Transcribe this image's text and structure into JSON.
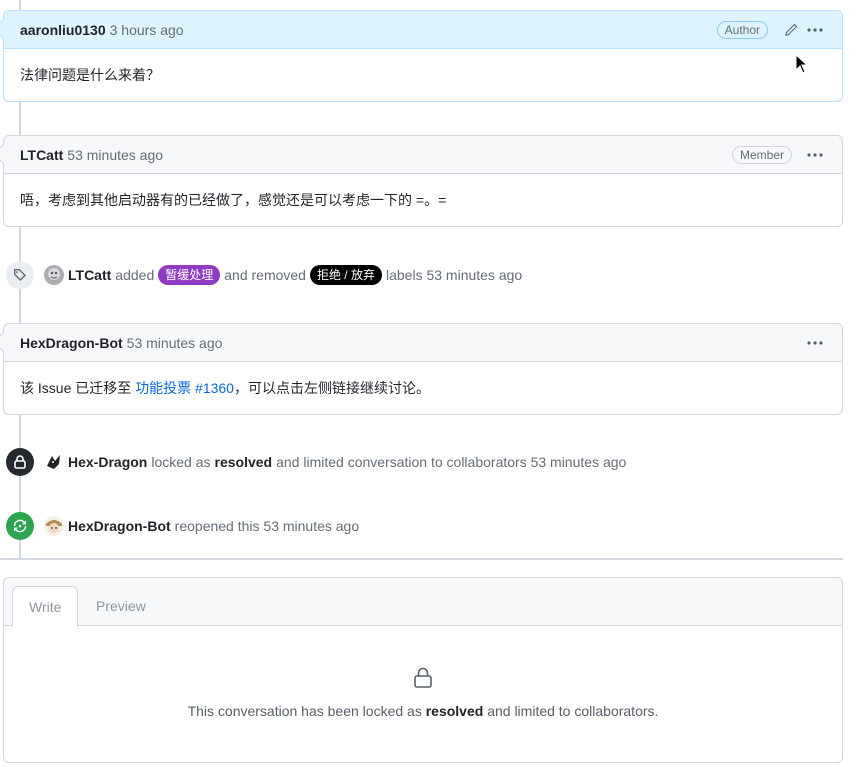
{
  "comments": [
    {
      "user": "aaronliu0130",
      "time": "3 hours ago",
      "role": "Author",
      "body": "法律问题是什么来着？"
    },
    {
      "user": "LTCatt",
      "time": "53 minutes ago",
      "role": "Member",
      "body": "唔，考虑到其他启动器有的已经做了，感觉还是可以考虑一下的 =。="
    },
    {
      "user": "HexDragon-Bot",
      "time": "53 minutes ago",
      "body_prefix": "该 Issue 已迁移至 ",
      "body_link": "功能投票 #1360",
      "body_suffix": "，可以点击左侧链接继续讨论。"
    }
  ],
  "events": {
    "labels": {
      "user": "LTCatt",
      "added_text": "added",
      "added_label": "暂缓处理",
      "added_label_color": "#8e3cc4",
      "removed_text": "and removed",
      "removed_label": "拒绝 / 放弃",
      "removed_label_color": "#000000",
      "suffix": "labels 53 minutes ago",
      "icon": "tag-icon"
    },
    "locked": {
      "user": "Hex-Dragon",
      "pre": "locked as",
      "reason": "resolved",
      "post": "and limited conversation to collaborators 53 minutes ago",
      "icon": "lock-icon"
    },
    "reopened": {
      "user": "HexDragon-Bot",
      "text": "reopened this 53 minutes ago",
      "icon": "reopen-icon"
    }
  },
  "composer": {
    "tabs": [
      "Write",
      "Preview"
    ],
    "locked_pre": "This conversation has been locked as",
    "locked_reason": "resolved",
    "locked_post": "and limited to collaborators."
  },
  "colors": {
    "author_header": "#ddf4ff",
    "link": "#0969da",
    "reopen_green": "#2da44e"
  }
}
